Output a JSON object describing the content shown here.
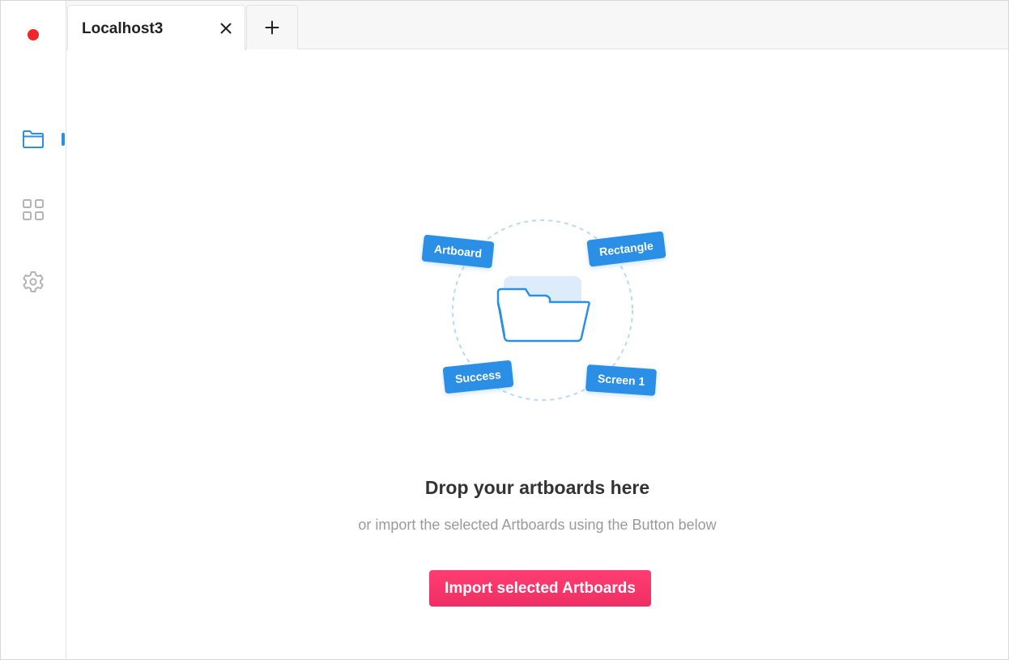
{
  "sidebar": {
    "record_color": "#f0262b",
    "items": [
      {
        "name": "files",
        "icon": "folder-icon",
        "active": true
      },
      {
        "name": "components",
        "icon": "grid-icon",
        "active": false
      },
      {
        "name": "settings",
        "icon": "gear-icon",
        "active": false
      }
    ],
    "accent": "#2b8fe6"
  },
  "tabs": {
    "active_label": "Localhost3",
    "close_icon": "close-icon",
    "add_icon": "plus-icon"
  },
  "illustration": {
    "chips": [
      "Artboard",
      "Rectangle",
      "Success",
      "Screen 1"
    ],
    "center_icon": "folder-icon"
  },
  "dropzone": {
    "title": "Drop your artboards here",
    "subtitle": "or import the selected Artboards using the Button below"
  },
  "import_button": {
    "label": "Import selected Artboards",
    "color": "#f72f67"
  }
}
